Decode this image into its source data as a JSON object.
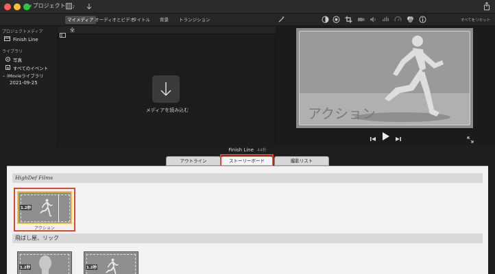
{
  "titlebar": {
    "back_label": "プロジェクト",
    "colors": {
      "close": "#ff5f57",
      "minimize": "#febc2e",
      "zoom": "#28c840"
    }
  },
  "toolbar": {
    "tabs": [
      {
        "label": "マイメディア",
        "active": true
      },
      {
        "label": "オーディオとビデオ",
        "active": false
      },
      {
        "label": "タイトル",
        "active": false
      },
      {
        "label": "背景",
        "active": false
      },
      {
        "label": "トランジション",
        "active": false
      }
    ],
    "reset_label": "すべてをリセット"
  },
  "sidebar": {
    "project_media_header": "プロジェクトメディア",
    "project_item": "Finish Line",
    "library_header": "ライブラリ",
    "items": [
      {
        "label": "写真",
        "icon": "photos-icon"
      },
      {
        "label": "すべてのイベント",
        "icon": "star-icon"
      }
    ],
    "imovie_library": "iMovieライブラリ",
    "event_date": "2021-09-25"
  },
  "media": {
    "filter_label": "全",
    "import_label": "メディアを読み込む"
  },
  "viewer": {
    "title_text": "アクション"
  },
  "bottom": {
    "project_title": "Finish Line",
    "duration": "44秒",
    "tabs": [
      {
        "label": "アウトライン",
        "active": false
      },
      {
        "label": "ストーリーボード",
        "active": true
      },
      {
        "label": "撮影リスト",
        "active": false
      }
    ],
    "sections": [
      {
        "header": "HighDef Films",
        "clips": [
          {
            "time": "1.2秒",
            "caption": "アクション"
          }
        ]
      },
      {
        "header": "飛ばし屋、リック",
        "clips": [
          {
            "time": "1.2秒"
          },
          {
            "time": "1.2秒"
          }
        ]
      }
    ]
  },
  "accent": {
    "highlight_red": "#e0462d",
    "clip_selected": "#e8c33a"
  }
}
